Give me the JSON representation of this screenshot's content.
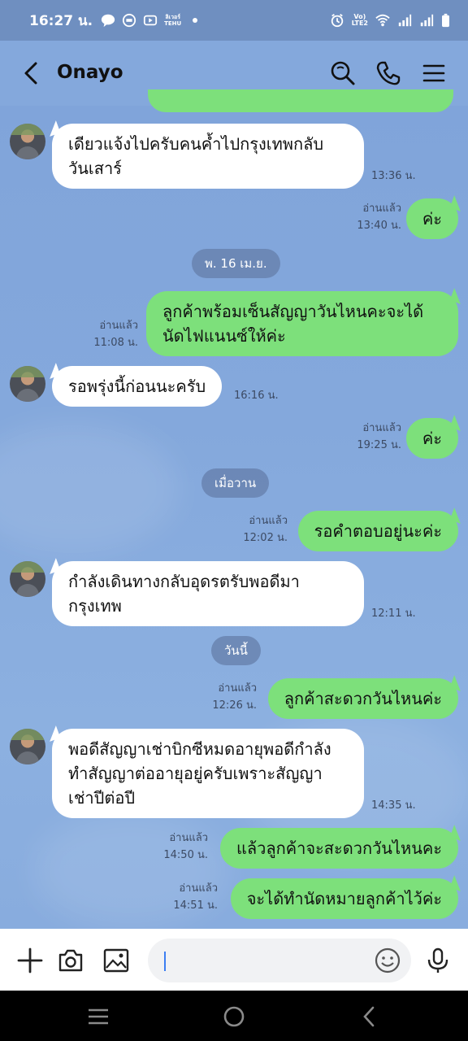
{
  "status_bar": {
    "time": "16:27 น.",
    "net_label_1": "Vo) LTE2",
    "net_label_top": "Vo)",
    "net_label_bottom": "LTE2",
    "carrier_icon_top": "ลิเวอร์",
    "carrier_icon_bottom": "TEHU"
  },
  "header": {
    "title": "Onayo"
  },
  "messages": [
    {
      "id": "m1",
      "dir": "in",
      "lines": [
        "เดียวแจ้งไปครับคนค้ำไปกรุงเทพกลับ",
        "วันเสาร์"
      ],
      "time": "13:36 น."
    },
    {
      "id": "m2",
      "dir": "out",
      "text": "ค่ะ",
      "read": "อ่านแล้ว",
      "time": "13:40 น."
    },
    {
      "id": "m3",
      "dir": "out",
      "lines": [
        "ลูกค้าพร้อมเซ็นสัญญาวันไหนคะจะได้",
        "นัดไฟแนนซ์ให้ค่ะ"
      ],
      "read": "อ่านแล้ว",
      "time": "11:08 น."
    },
    {
      "id": "m4",
      "dir": "in",
      "text": "รอพรุ่งนี้ก่อนนะครับ",
      "time": "16:16 น."
    },
    {
      "id": "m5",
      "dir": "out",
      "text": "ค่ะ",
      "read": "อ่านแล้ว",
      "time": "19:25 น."
    },
    {
      "id": "m6",
      "dir": "out",
      "text": "รอคำตอบอยู่นะค่ะ",
      "read": "อ่านแล้ว",
      "time": "12:02 น."
    },
    {
      "id": "m7",
      "dir": "in",
      "lines": [
        "กำลังเดินทางกลับอุดรตรับพอดีมา",
        "กรุงเทพ"
      ],
      "time": "12:11 น."
    },
    {
      "id": "m8",
      "dir": "out",
      "text": "ลูกค้าสะดวกวันไหนค่ะ",
      "read": "อ่านแล้ว",
      "time": "12:26 น."
    },
    {
      "id": "m9",
      "dir": "in",
      "lines": [
        "พอดีสัญญาเช่าบิกซีหมดอายุพอดีกำลัง",
        "ทำสัญญาต่ออายุอยู่ครับเพราะสัญญา",
        "เช่าปีต่อปี"
      ],
      "time": "14:35 น."
    },
    {
      "id": "m10",
      "dir": "out",
      "text": "แล้วลูกค้าจะสะดวกวันไหนคะ",
      "read": "อ่านแล้ว",
      "time": "14:50 น."
    },
    {
      "id": "m11",
      "dir": "out",
      "text": "จะได้ทำนัดหมายลูกค้าไว้ค่ะ",
      "read": "อ่านแล้ว",
      "time": "14:51 น."
    }
  ],
  "date_chips": {
    "d1": "พ. 16 เม.ย.",
    "d2": "เมื่อวาน",
    "d3": "วันนี้"
  },
  "input": {
    "value": ""
  },
  "icons": {
    "header": [
      "back-icon",
      "search-icon",
      "phone-icon",
      "menu-icon"
    ],
    "input": [
      "plus-icon",
      "camera-icon",
      "image-icon",
      "emoji-icon",
      "mic-icon"
    ],
    "nav": [
      "recent-apps-icon",
      "home-icon",
      "back-nav-icon"
    ]
  },
  "colors": {
    "outgoing_bubble": "#7de07b",
    "incoming_bubble": "#ffffff",
    "chat_background": "#84a8dc"
  }
}
